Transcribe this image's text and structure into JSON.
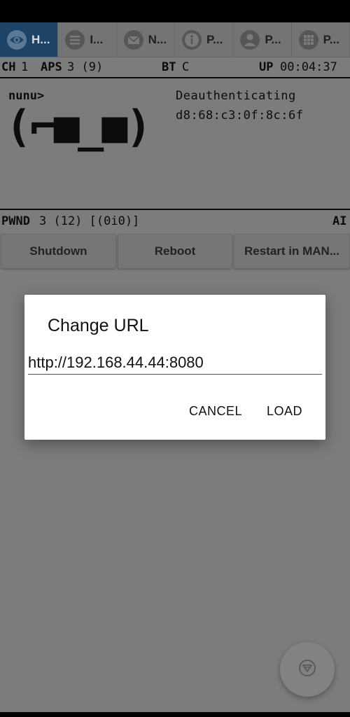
{
  "tabs": [
    {
      "label": "H...",
      "icon": "eye-icon",
      "active": true
    },
    {
      "label": "I...",
      "icon": "list-icon",
      "active": false
    },
    {
      "label": "N...",
      "icon": "mail-icon",
      "active": false
    },
    {
      "label": "P...",
      "icon": "info-icon",
      "active": false
    },
    {
      "label": "P...",
      "icon": "person-icon",
      "active": false
    },
    {
      "label": "P...",
      "icon": "grid-icon",
      "active": false
    }
  ],
  "screen": {
    "ch_label": "CH",
    "ch_value": "1",
    "aps_label": "APS",
    "aps_value": "3 (9)",
    "bt_label": "BT",
    "bt_value": "C",
    "up_label": "UP",
    "up_value": "00:04:37",
    "name": "nunu>",
    "face": "(⌐■_■)",
    "status_line1": "Deauthenticating",
    "status_line2": "d8:68:c3:0f:8c:6f",
    "pwnd_label": "PWND",
    "pwnd_value": "3 (12) [(0i0)]",
    "mode": "AI"
  },
  "actions": {
    "shutdown": "Shutdown",
    "reboot": "Reboot",
    "restart": "Restart in MAN..."
  },
  "dialog": {
    "title": "Change URL",
    "url_value": "http://192.168.44.44:8080",
    "cancel": "CANCEL",
    "load": "LOAD"
  },
  "fab": {
    "icon": "scroll-down-icon"
  },
  "colors": {
    "scrim": "#7c7c7c",
    "active_tab": "#1d4466",
    "dialog": "#ffffff"
  }
}
